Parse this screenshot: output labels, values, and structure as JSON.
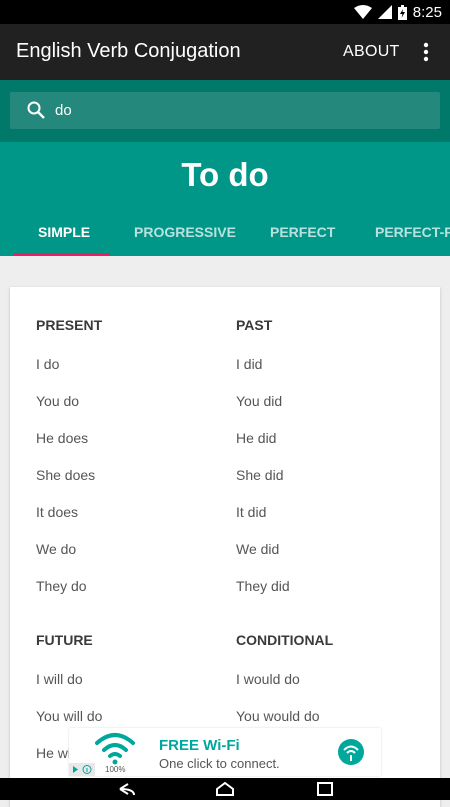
{
  "status_bar": {
    "time": "8:25"
  },
  "app_bar": {
    "title": "English Verb Conjugation",
    "about_label": "ABOUT"
  },
  "search": {
    "value": "do"
  },
  "verb_title": "To do",
  "tabs": [
    {
      "label": "SIMPLE",
      "active": true
    },
    {
      "label": "PROGRESSIVE",
      "active": false
    },
    {
      "label": "PERFECT",
      "active": false
    },
    {
      "label": "PERFECT-PR",
      "active": false
    }
  ],
  "tenses": {
    "present": {
      "heading": "PRESENT",
      "forms": [
        "I do",
        "You do",
        "He does",
        "She does",
        "It does",
        "We do",
        "They do"
      ]
    },
    "past": {
      "heading": "PAST",
      "forms": [
        "I did",
        "You did",
        "He did",
        "She did",
        "It did",
        "We did",
        "They did"
      ]
    },
    "future": {
      "heading": "FUTURE",
      "forms": [
        "I will do",
        "You will do",
        "He wi"
      ]
    },
    "conditional": {
      "heading": "CONDITIONAL",
      "forms": [
        "I would do",
        "You would do"
      ]
    }
  },
  "ad": {
    "title": "FREE Wi-Fi",
    "subtitle": "One click to connect.",
    "percent": "100%"
  },
  "colors": {
    "primary": "#009688",
    "primary_dark": "#00796b",
    "accent": "#e91e63",
    "appbar": "#212121"
  },
  "icons": [
    "wifi-icon",
    "signal-icon",
    "battery-icon",
    "more-vert-icon",
    "search-icon",
    "back-icon",
    "home-icon",
    "recents-icon"
  ]
}
